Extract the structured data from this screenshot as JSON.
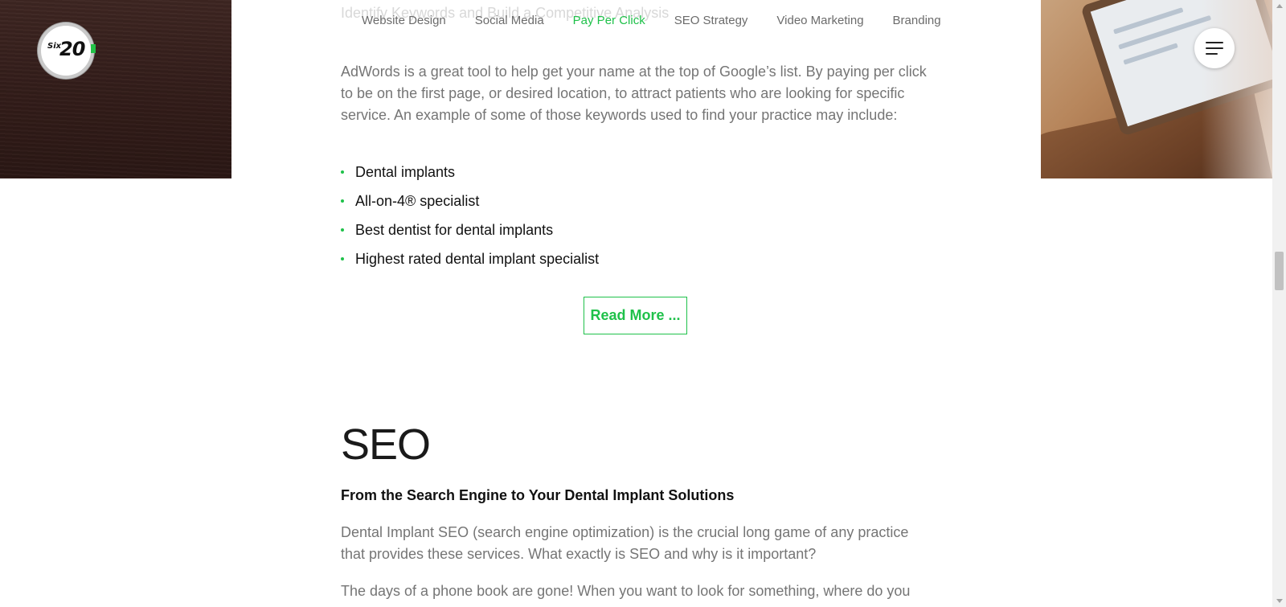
{
  "logo": {
    "small_text": "Six",
    "big_text": "20"
  },
  "ghost_heading": "Identify Keywords and Build a Competitive Analysis",
  "subnav": {
    "items": [
      {
        "label": "Website Design",
        "active": false
      },
      {
        "label": "Social Media",
        "active": false
      },
      {
        "label": "Pay Per Click",
        "active": true
      },
      {
        "label": "SEO Strategy",
        "active": false
      },
      {
        "label": "Video Marketing",
        "active": false
      },
      {
        "label": "Branding",
        "active": false
      }
    ]
  },
  "ppc": {
    "paragraph": "AdWords is a great tool to help get your name at the top of Google’s list. By paying per click to be on the first page, or desired location, to attract patients who are looking for specific service. An example of some of those keywords used to find your practice may include:",
    "keywords": [
      "Dental implants",
      "All-on-4® specialist",
      "Best dentist for dental implants",
      "Highest rated dental implant specialist"
    ],
    "read_more_label": "Read More ..."
  },
  "seo": {
    "title": "SEO",
    "subtitle": "From the Search Engine to Your Dental Implant Solutions",
    "paragraph1": "Dental Implant SEO (search engine optimization) is the crucial long game of any practice that provides these services. What exactly is SEO and why is it important?",
    "paragraph2": "The days of a phone book are gone! When you want to look for something, where do you"
  },
  "colors": {
    "accent": "#1fc14a",
    "body_text": "#757575",
    "heading_text": "#1a1a1a"
  },
  "icons": {
    "menu": "hamburger-menu-icon"
  }
}
